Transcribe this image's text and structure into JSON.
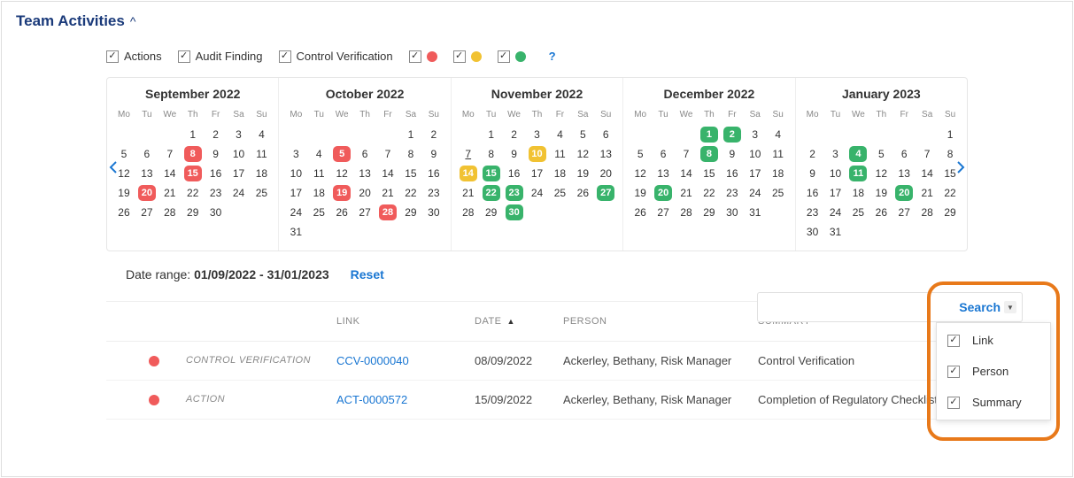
{
  "header": {
    "title": "Team Activities"
  },
  "filters": {
    "actions": {
      "label": "Actions",
      "checked": true
    },
    "audit_finding": {
      "label": "Audit Finding",
      "checked": true
    },
    "control_verification": {
      "label": "Control Verification",
      "checked": true
    },
    "red": {
      "checked": true
    },
    "yellow": {
      "checked": true
    },
    "green": {
      "checked": true
    }
  },
  "dow": [
    "Mo",
    "Tu",
    "We",
    "Th",
    "Fr",
    "Sa",
    "Su"
  ],
  "months": [
    {
      "title": "September 2022",
      "offset": 3,
      "days": 30,
      "marks": {
        "8": "red",
        "15": "red",
        "20": "red"
      }
    },
    {
      "title": "October 2022",
      "offset": 5,
      "days": 31,
      "marks": {
        "5": "red",
        "19": "red",
        "28": "red"
      }
    },
    {
      "title": "November 2022",
      "offset": 1,
      "days": 30,
      "marks": {
        "10": "yellow",
        "14": "yellow",
        "15": "green",
        "22": "green",
        "23": "green",
        "27": "green",
        "30": "green"
      },
      "underline": [
        "7"
      ]
    },
    {
      "title": "December 2022",
      "offset": 3,
      "days": 31,
      "marks": {
        "1": "green",
        "2": "green",
        "8": "green",
        "20": "green"
      }
    },
    {
      "title": "January 2023",
      "offset": 6,
      "days": 31,
      "marks": {
        "4": "green",
        "11": "green",
        "20": "green"
      }
    }
  ],
  "date_range": {
    "label": "Date range: ",
    "value": "01/09/2022 - 31/01/2023",
    "reset": "Reset"
  },
  "search": {
    "button": "Search",
    "value": ""
  },
  "table": {
    "headers": {
      "link": "LINK",
      "date": "DATE",
      "person": "PERSON",
      "summary": "SUMMARY"
    },
    "rows": [
      {
        "dot": "red",
        "type": "CONTROL VERIFICATION",
        "link": "CCV-0000040",
        "date": "08/09/2022",
        "person": "Ackerley, Bethany, Risk Manager",
        "summary": "Control Verification"
      },
      {
        "dot": "red",
        "type": "ACTION",
        "link": "ACT-0000572",
        "date": "15/09/2022",
        "person": "Ackerley, Bethany, Risk Manager",
        "summary": "Completion of Regulatory Checklist"
      }
    ]
  },
  "dropdown": {
    "link": {
      "label": "Link",
      "checked": true
    },
    "person": {
      "label": "Person",
      "checked": true
    },
    "summary": {
      "label": "Summary",
      "checked": true
    }
  }
}
